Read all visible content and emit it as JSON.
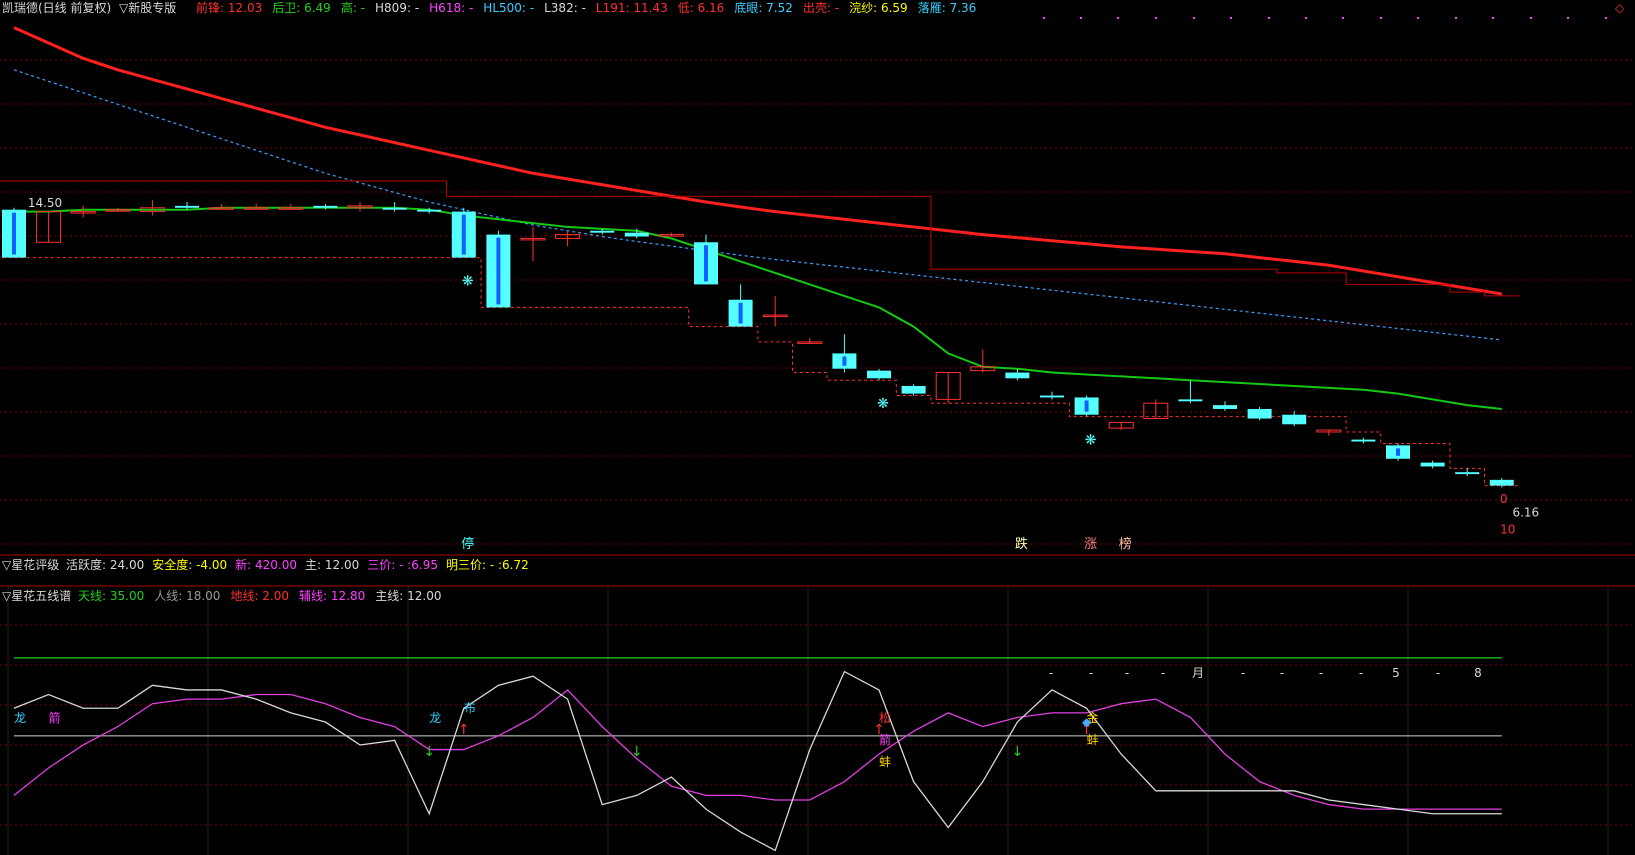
{
  "colors": {
    "bg": "#000000",
    "grid": "#7a0000",
    "up": "#ff3030",
    "down": "#54ffff",
    "ma_red": "#ff2020",
    "ma_blue": "#3aa0ff",
    "ma_green": "#14c814",
    "purple": "#e040e0",
    "white": "#d8d8d8",
    "yellow": "#ffff00",
    "cyan": "#38d0ff",
    "green_label": "#20d020",
    "magenta": "#ff40ff",
    "red_label": "#ff3030"
  },
  "header": {
    "title": "凯瑞德(日线 前复权)",
    "market": "▽新股专版",
    "items": [
      {
        "label": "前锋:",
        "value": "12.03",
        "color": "#ff3030"
      },
      {
        "label": "后卫:",
        "value": "6.49",
        "color": "#20d020"
      },
      {
        "label": "高:",
        "value": "-",
        "color": "#20d020"
      },
      {
        "label": "H809:",
        "value": "-",
        "color": "#d8d8d8"
      },
      {
        "label": "H618:",
        "value": "-",
        "color": "#ff40ff"
      },
      {
        "label": "HL500:",
        "value": "-",
        "color": "#38d0ff"
      },
      {
        "label": "L382:",
        "value": "-",
        "color": "#d8d8d8"
      },
      {
        "label": "L191:",
        "value": "11.43",
        "color": "#ff3030"
      },
      {
        "label": "低:",
        "value": "6.16",
        "color": "#ff3030"
      },
      {
        "label": "底眼:",
        "value": "7.52",
        "color": "#38d0ff"
      },
      {
        "label": "出壳:",
        "value": "-",
        "color": "#ff3030"
      },
      {
        "label": "浣纱:",
        "value": "6.59",
        "color": "#ffff00"
      },
      {
        "label": "落雁:",
        "value": "7.36",
        "color": "#38d0ff"
      }
    ],
    "diamond": "◇"
  },
  "panel2": {
    "title": "▽星花评级",
    "items": [
      {
        "label": "活跃度:",
        "value": "24.00",
        "color": "#d8d8d8"
      },
      {
        "label": "安全度:",
        "value": "-4.00",
        "color": "#ffff00"
      },
      {
        "label": "新:",
        "value": "420.00",
        "color": "#ff40ff"
      },
      {
        "label": "主:",
        "value": "12.00",
        "color": "#d8d8d8"
      },
      {
        "label": "三价:",
        "value": "-   :6.95",
        "color": "#ff40ff"
      },
      {
        "label": "明三价:",
        "value": "-   :6.72",
        "color": "#ffff00"
      }
    ]
  },
  "panel3": {
    "title": "▽星花五线谱",
    "items": [
      {
        "label": "天线:",
        "value": "35.00",
        "color": "#20d020"
      },
      {
        "label": "人线:",
        "value": "18.00",
        "color": "#999999"
      },
      {
        "label": "地线:",
        "value": "2.00",
        "color": "#ff3030"
      },
      {
        "label": "辅线:",
        "value": "12.80",
        "color": "#ff40ff"
      },
      {
        "label": "主线:",
        "value": "12.00",
        "color": "#d8d8d8"
      }
    ]
  },
  "chart_data": [
    {
      "type": "candlestick",
      "ylim": [
        5.8,
        19.5
      ],
      "price_high_label": "14.50",
      "price_low_label": "6.16",
      "right_labels": [
        "0",
        "10"
      ],
      "candles": [
        {
          "o": 14.55,
          "h": 14.6,
          "l": 13.3,
          "c": 13.3
        },
        {
          "o": 13.7,
          "h": 14.5,
          "l": 13.7,
          "c": 14.5
        },
        {
          "o": 14.5,
          "h": 14.65,
          "l": 14.35,
          "c": 14.5
        },
        {
          "o": 14.55,
          "h": 14.6,
          "l": 14.5,
          "c": 14.55
        },
        {
          "o": 14.5,
          "h": 14.8,
          "l": 14.4,
          "c": 14.6
        },
        {
          "o": 14.65,
          "h": 14.75,
          "l": 14.55,
          "c": 14.6
        },
        {
          "o": 14.6,
          "h": 14.7,
          "l": 14.55,
          "c": 14.6
        },
        {
          "o": 14.6,
          "h": 14.7,
          "l": 14.55,
          "c": 14.6
        },
        {
          "o": 14.6,
          "h": 14.7,
          "l": 14.55,
          "c": 14.6
        },
        {
          "o": 14.65,
          "h": 14.7,
          "l": 14.55,
          "c": 14.6
        },
        {
          "o": 14.6,
          "h": 14.75,
          "l": 14.5,
          "c": 14.65
        },
        {
          "o": 14.6,
          "h": 14.75,
          "l": 14.5,
          "c": 14.55
        },
        {
          "o": 14.55,
          "h": 14.6,
          "l": 14.45,
          "c": 14.5
        },
        {
          "o": 14.5,
          "h": 14.6,
          "l": 13.3,
          "c": 13.3
        },
        {
          "o": 13.9,
          "h": 14.0,
          "l": 12.0,
          "c": 12.0
        },
        {
          "o": 13.8,
          "h": 14.1,
          "l": 13.2,
          "c": 13.8
        },
        {
          "o": 13.8,
          "h": 14.0,
          "l": 13.6,
          "c": 13.9
        },
        {
          "o": 14.0,
          "h": 14.05,
          "l": 13.9,
          "c": 13.95
        },
        {
          "o": 13.95,
          "h": 14.05,
          "l": 13.8,
          "c": 13.85
        },
        {
          "o": 13.9,
          "h": 13.95,
          "l": 13.85,
          "c": 13.9
        },
        {
          "o": 13.7,
          "h": 13.9,
          "l": 12.6,
          "c": 12.6
        },
        {
          "o": 12.2,
          "h": 12.6,
          "l": 11.5,
          "c": 11.5
        },
        {
          "o": 11.8,
          "h": 12.3,
          "l": 11.5,
          "c": 11.8
        },
        {
          "o": 11.1,
          "h": 11.2,
          "l": 11.05,
          "c": 11.1
        },
        {
          "o": 10.8,
          "h": 11.3,
          "l": 10.3,
          "c": 10.4
        },
        {
          "o": 10.35,
          "h": 10.4,
          "l": 10.1,
          "c": 10.15
        },
        {
          "o": 9.95,
          "h": 10.0,
          "l": 9.7,
          "c": 9.75
        },
        {
          "o": 9.6,
          "h": 10.3,
          "l": 9.5,
          "c": 10.3
        },
        {
          "o": 10.35,
          "h": 10.9,
          "l": 10.3,
          "c": 10.45
        },
        {
          "o": 10.3,
          "h": 10.4,
          "l": 10.1,
          "c": 10.15
        },
        {
          "o": 9.7,
          "h": 9.8,
          "l": 9.6,
          "c": 9.65
        },
        {
          "o": 9.65,
          "h": 9.7,
          "l": 9.15,
          "c": 9.2
        },
        {
          "o": 8.85,
          "h": 9.0,
          "l": 8.8,
          "c": 9.0
        },
        {
          "o": 9.1,
          "h": 9.6,
          "l": 9.1,
          "c": 9.5
        },
        {
          "o": 9.6,
          "h": 10.1,
          "l": 9.5,
          "c": 9.55
        },
        {
          "o": 9.45,
          "h": 9.55,
          "l": 9.3,
          "c": 9.35
        },
        {
          "o": 9.35,
          "h": 9.4,
          "l": 9.05,
          "c": 9.1
        },
        {
          "o": 9.2,
          "h": 9.3,
          "l": 8.9,
          "c": 8.95
        },
        {
          "o": 8.75,
          "h": 8.8,
          "l": 8.65,
          "c": 8.8
        },
        {
          "o": 8.55,
          "h": 8.6,
          "l": 8.45,
          "c": 8.5
        },
        {
          "o": 8.4,
          "h": 8.45,
          "l": 8.0,
          "c": 8.05
        },
        {
          "o": 7.95,
          "h": 8.0,
          "l": 7.8,
          "c": 7.85
        },
        {
          "o": 7.7,
          "h": 7.8,
          "l": 7.6,
          "c": 7.65
        },
        {
          "o": 7.5,
          "h": 7.55,
          "l": 7.3,
          "c": 7.35
        }
      ],
      "ma_red": [
        19.3,
        18.9,
        18.5,
        18.2,
        17.95,
        17.7,
        17.45,
        17.2,
        16.95,
        16.7,
        16.5,
        16.3,
        16.1,
        15.9,
        15.7,
        15.5,
        15.35,
        15.2,
        15.05,
        14.9,
        14.75,
        14.62,
        14.5,
        14.4,
        14.3,
        14.2,
        14.1,
        14.0,
        13.9,
        13.82,
        13.74,
        13.66,
        13.58,
        13.52,
        13.46,
        13.4,
        13.3,
        13.2,
        13.1,
        12.95,
        12.8,
        12.65,
        12.5,
        12.35
      ],
      "ma_blue": [
        18.2,
        17.9,
        17.6,
        17.3,
        17.0,
        16.7,
        16.4,
        16.1,
        15.8,
        15.5,
        15.25,
        15.0,
        14.75,
        14.55,
        14.35,
        14.15,
        14.0,
        13.85,
        13.72,
        13.6,
        13.48,
        13.36,
        13.25,
        13.15,
        13.05,
        12.95,
        12.85,
        12.75,
        12.65,
        12.55,
        12.45,
        12.35,
        12.25,
        12.15,
        12.05,
        11.95,
        11.85,
        11.75,
        11.65,
        11.55,
        11.45,
        11.35,
        11.25,
        11.15
      ],
      "ma_green": [
        14.5,
        14.5,
        14.55,
        14.55,
        14.55,
        14.55,
        14.6,
        14.6,
        14.6,
        14.6,
        14.6,
        14.6,
        14.55,
        14.4,
        14.3,
        14.2,
        14.1,
        14.05,
        14.0,
        13.8,
        13.5,
        13.2,
        12.9,
        12.6,
        12.3,
        12.0,
        11.5,
        10.8,
        10.45,
        10.4,
        10.3,
        10.25,
        10.2,
        10.15,
        10.1,
        10.05,
        10.0,
        9.95,
        9.9,
        9.85,
        9.75,
        9.6,
        9.45,
        9.35
      ],
      "resist": [
        15.3,
        15.3,
        15.3,
        15.3,
        15.3,
        15.3,
        15.3,
        15.3,
        15.3,
        15.3,
        15.3,
        15.3,
        15.3,
        14.9,
        14.9,
        14.9,
        14.9,
        14.9,
        14.9,
        14.9,
        14.9,
        14.9,
        14.9,
        14.9,
        14.9,
        14.9,
        14.9,
        13.0,
        13.0,
        13.0,
        13.0,
        13.0,
        13.0,
        13.0,
        13.0,
        13.0,
        13.0,
        12.9,
        12.9,
        12.6,
        12.6,
        12.6,
        12.4,
        12.3
      ],
      "support": [
        13.3,
        13.3,
        13.3,
        13.3,
        13.3,
        13.3,
        13.3,
        13.3,
        13.3,
        13.3,
        13.3,
        13.3,
        13.3,
        13.3,
        12.0,
        12.0,
        12.0,
        12.0,
        12.0,
        12.0,
        11.5,
        11.5,
        11.1,
        10.3,
        10.1,
        10.1,
        9.7,
        9.5,
        9.5,
        9.5,
        9.5,
        9.15,
        9.15,
        9.15,
        9.15,
        9.15,
        9.15,
        9.15,
        9.15,
        8.75,
        8.45,
        8.45,
        7.8,
        7.35
      ],
      "signals": [
        {
          "i": 13,
          "text": "停",
          "color": "#54ffff"
        },
        {
          "i": 29,
          "text": "跌",
          "color": "#ffffaa"
        },
        {
          "i": 31,
          "text": "涨",
          "color": "#ff8080"
        },
        {
          "i": 32,
          "text": "榜",
          "color": "#ffc0a0"
        }
      ],
      "butterflies": [
        13,
        25,
        31
      ]
    },
    {
      "type": "line",
      "ylim": [
        -8,
        45
      ],
      "series": [
        {
          "name": "天线",
          "color": "#20d020",
          "values": [
            35,
            35,
            35,
            35,
            35,
            35,
            35,
            35,
            35,
            35,
            35,
            35,
            35,
            35,
            35,
            35,
            35,
            35,
            35,
            35,
            35,
            35,
            35,
            35,
            35,
            35,
            35,
            35,
            35,
            35,
            35,
            35,
            35,
            35,
            35,
            35,
            35,
            35,
            35,
            35,
            35,
            35,
            35,
            35
          ]
        },
        {
          "name": "人线",
          "color": "#999999",
          "values": [
            18,
            18,
            18,
            18,
            18,
            18,
            18,
            18,
            18,
            18,
            18,
            18,
            18,
            18,
            18,
            18,
            18,
            18,
            18,
            18,
            18,
            18,
            18,
            18,
            18,
            18,
            18,
            18,
            18,
            18,
            18,
            18,
            18,
            18,
            18,
            18,
            18,
            18,
            18,
            18,
            18,
            18,
            18,
            18
          ]
        },
        {
          "name": "辅线",
          "color": "#e040e0",
          "values": [
            5,
            11,
            16,
            20,
            25,
            26,
            26,
            27,
            27,
            25,
            22,
            20,
            15,
            15,
            18,
            22,
            28,
            20,
            13,
            7,
            5,
            5,
            4,
            4,
            8,
            14,
            19,
            23,
            20,
            22,
            23,
            23,
            25,
            26,
            22,
            14,
            8,
            5,
            3,
            2,
            2,
            2,
            2,
            2
          ]
        },
        {
          "name": "主线",
          "color": "#d8d8d8",
          "values": [
            24,
            27,
            24,
            24,
            29,
            28,
            28,
            26,
            23,
            21,
            16,
            17,
            1,
            24,
            29,
            31,
            26,
            3,
            5,
            9,
            2,
            -3,
            -7,
            15,
            32,
            28,
            8,
            -2,
            8,
            21,
            28,
            24,
            14,
            6,
            6,
            6,
            6,
            6,
            4,
            3,
            2,
            1,
            1,
            1
          ]
        }
      ],
      "markers": [
        {
          "i": 0,
          "text": "龙",
          "color": "#38d0ff"
        },
        {
          "i": 1,
          "text": "箭",
          "color": "#ff40ff"
        },
        {
          "i": 12,
          "text": "龙",
          "color": "#38d0ff"
        },
        {
          "i": 13,
          "text": "布",
          "color": "#38d0ff"
        },
        {
          "i": 25,
          "text": "松",
          "color": "#ff3030"
        },
        {
          "i": 25,
          "text": "箭",
          "color": "#ff40ff"
        },
        {
          "i": 25,
          "text": "蚌",
          "color": "#ffd000"
        },
        {
          "i": 31,
          "text": "金",
          "color": "#ffd000"
        },
        {
          "i": 31,
          "text": "蚌",
          "color": "#ffd000"
        }
      ],
      "arrows_down": [
        12,
        18,
        29
      ],
      "arrows_up": [
        13,
        25,
        31
      ],
      "dash_row": [
        "-",
        "-",
        "-",
        "-",
        "月",
        "-",
        "-",
        "-",
        "-",
        "5",
        "-",
        "8"
      ]
    }
  ]
}
